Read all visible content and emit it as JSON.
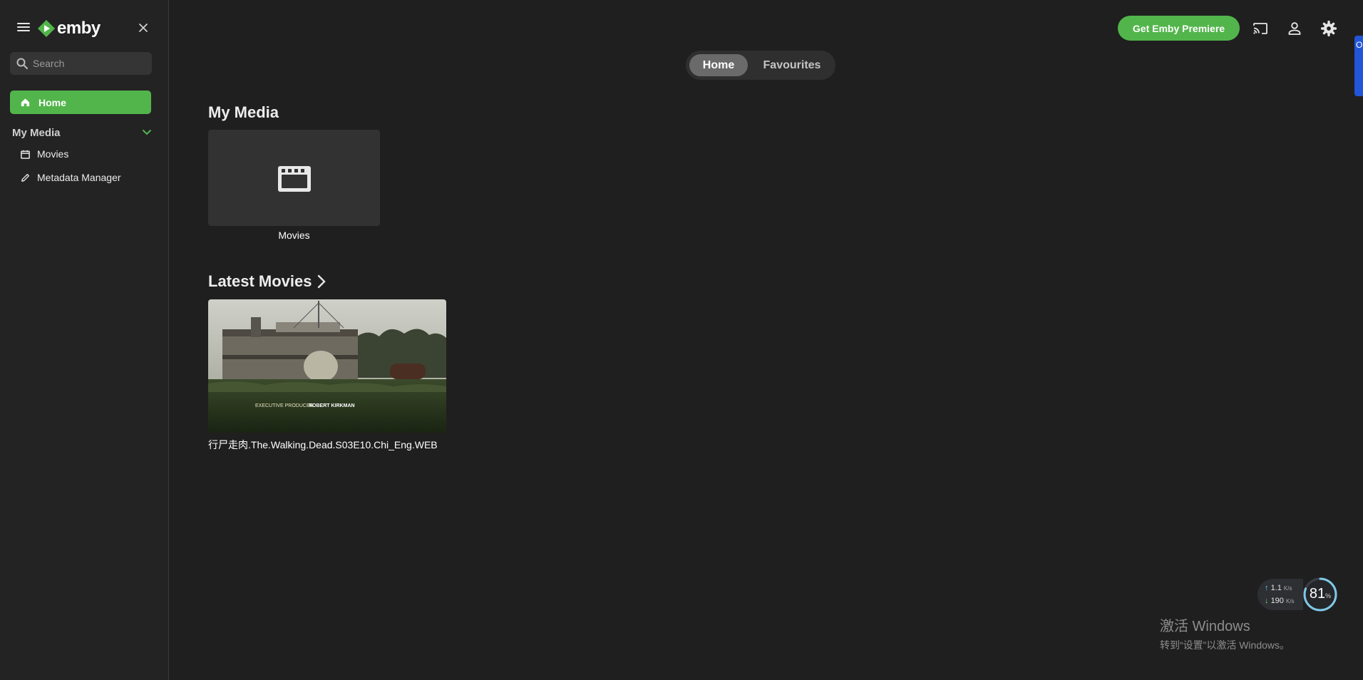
{
  "sidebar": {
    "logo_text": "emby",
    "search_placeholder": "Search",
    "home_label": "Home",
    "section_title": "My Media",
    "items": [
      {
        "label": "Movies",
        "icon": "calendar-icon"
      },
      {
        "label": "Metadata Manager",
        "icon": "pencil-icon"
      }
    ]
  },
  "header": {
    "premiere_label": "Get Emby Premiere",
    "icons": [
      "cast-icon",
      "user-icon",
      "settings-gear-icon"
    ],
    "edge_badge_text": "O"
  },
  "tabs": [
    {
      "label": "Home",
      "active": true
    },
    {
      "label": "Favourites",
      "active": false
    }
  ],
  "main": {
    "my_media_title": "My Media",
    "libraries": [
      {
        "label": "Movies",
        "icon": "clapperboard-icon"
      }
    ],
    "latest_title": "Latest Movies",
    "latest_items": [
      {
        "title": "行尸走肉.The.Walking.Dead.S03E10.Chi_Eng.WEB",
        "credit_left": "EXECUTIVE PRODUCER",
        "credit_right": "ROBERT KIRKMAN"
      }
    ]
  },
  "network_widget": {
    "upload": "1.1",
    "upload_unit": "K/s",
    "download": "190",
    "download_unit": "K/s",
    "percent": "81",
    "percent_unit": "%"
  },
  "watermark": {
    "title": "激活 Windows",
    "subtitle": "转到“设置”以激活 Windows。"
  },
  "colors": {
    "accent": "#52b54b",
    "background": "#1f1f1f",
    "sidebar": "#232323"
  }
}
